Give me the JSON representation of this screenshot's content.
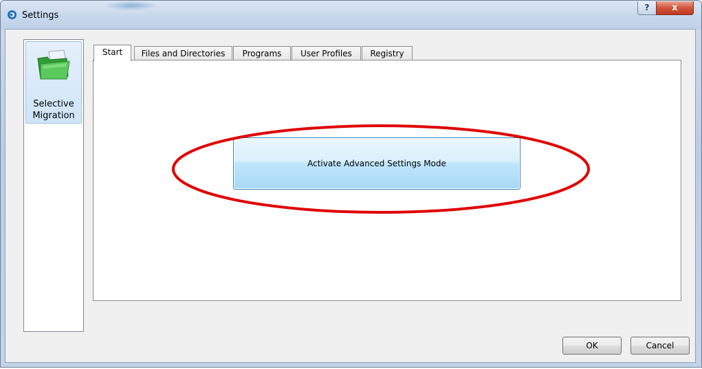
{
  "window": {
    "title": "Settings",
    "help_glyph": "?",
    "close_glyph": "x"
  },
  "sidebar": {
    "items": [
      {
        "label": "Selective\nMigration",
        "icon": "folder-icon"
      }
    ]
  },
  "tabs": [
    {
      "label": "Start",
      "active": true
    },
    {
      "label": "Files and Directories",
      "active": false
    },
    {
      "label": "Programs",
      "active": false
    },
    {
      "label": "User Profiles",
      "active": false
    },
    {
      "label": "Registry",
      "active": false
    }
  ],
  "main": {
    "activate_button_label": "Activate Advanced Settings Mode"
  },
  "footer": {
    "ok_label": "OK",
    "cancel_label": "Cancel"
  },
  "colors": {
    "annotation_ring": "#e00000",
    "button_accent": "#3c7fb1",
    "close_red": "#c23a22"
  }
}
